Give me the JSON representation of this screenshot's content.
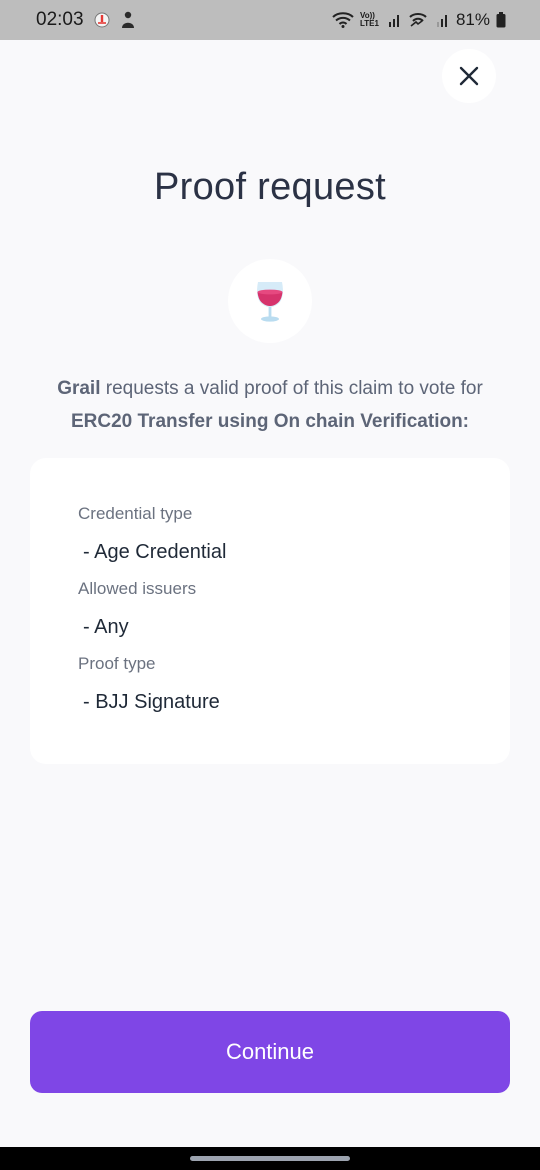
{
  "status_bar": {
    "time": "02:03",
    "battery": "81%",
    "icons": [
      "notification-icon",
      "avatar-icon",
      "wifi-icon",
      "volte-icon",
      "signal-icon",
      "wifi-calling-icon",
      "signal-icon",
      "battery-icon"
    ],
    "volte_label": "Vo)) LTE1"
  },
  "header": {
    "title": "Proof request"
  },
  "app": {
    "logo_icon": "wine-glass-icon"
  },
  "request": {
    "requester": "Grail",
    "text": " requests a valid proof of this claim to vote for",
    "purpose": "ERC20 Transfer using On chain Verification:"
  },
  "details": {
    "credential_type_label": "Credential type",
    "credential_type_value": "- Age Credential",
    "allowed_issuers_label": "Allowed issuers",
    "allowed_issuers_value": "- Any",
    "proof_type_label": "Proof type",
    "proof_type_value": "- BJJ Signature"
  },
  "actions": {
    "continue_label": "Continue"
  },
  "colors": {
    "accent": "#7f46e6",
    "background": "#f9f9fb"
  }
}
